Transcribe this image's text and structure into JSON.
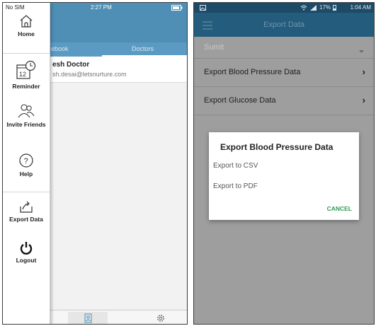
{
  "left_phone": {
    "status": {
      "carrier": "No SIM",
      "time": "2:27 PM"
    },
    "tabs": [
      {
        "label": "ebook"
      },
      {
        "label": "Doctors"
      }
    ],
    "contact": {
      "name": "esh Doctor",
      "email": "sh.desai@letsnurture.com"
    },
    "drawer": {
      "items": [
        {
          "label": "Home",
          "icon": "home-icon"
        },
        {
          "label": "Reminder",
          "icon": "calendar-clock-icon",
          "date": "12"
        },
        {
          "label": "Invite Friends",
          "icon": "invite-friends-icon"
        },
        {
          "label": "Help",
          "icon": "help-icon",
          "glyph": "?"
        },
        {
          "label": "Export Data",
          "icon": "export-icon"
        },
        {
          "label": "Logout",
          "icon": "power-icon"
        }
      ]
    }
  },
  "right_phone": {
    "status": {
      "right_text": "17%",
      "time": "1:04 AM"
    },
    "toolbar": {
      "title": "Export Data"
    },
    "selector": {
      "value": "Sumit"
    },
    "rows": [
      {
        "label": "Export Blood Pressure Data"
      },
      {
        "label": "Export Glucose Data"
      }
    ],
    "dialog": {
      "title": "Export Blood Pressure Data",
      "options": [
        {
          "label": "Export to CSV"
        },
        {
          "label": "Export to PDF"
        }
      ],
      "cancel": "CANCEL"
    }
  },
  "colors": {
    "ios_header": "#4f8fb5",
    "android_toolbar": "#245c7d",
    "cancel_green": "#2e9b53"
  }
}
